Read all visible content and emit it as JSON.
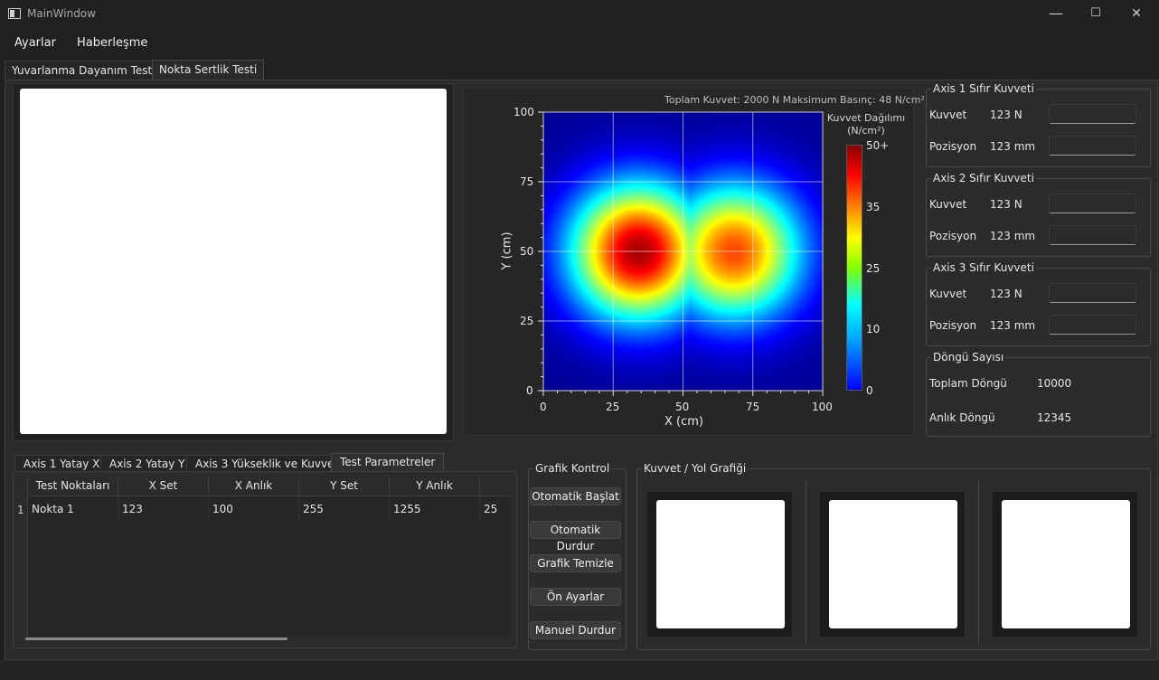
{
  "window": {
    "title": "MainWindow",
    "minimize": "—",
    "maximize": "☐",
    "close": "✕"
  },
  "menu": {
    "items": [
      "Ayarlar",
      "Haberleşme"
    ]
  },
  "main_tabs": [
    "Yuvarlanma Dayanım Testi",
    "Nokta Sertlik Testi"
  ],
  "main_tabs_active": "Nokta Sertlik Testi",
  "heatmap": {
    "info": "Toplam Kuvvet: 2000 N  Maksimum Basınç: 48 N/cm²",
    "colorbar_title_1": "Kuvvet Dağılımı",
    "colorbar_title_2": "(N/cm²)",
    "colorbar_ticks": [
      "50+",
      "35",
      "25",
      "10",
      "0"
    ],
    "x_ticks": [
      "0",
      "25",
      "50",
      "75",
      "100"
    ],
    "y_ticks": [
      "100",
      "75",
      "50",
      "25",
      "0"
    ],
    "xlabel": "X (cm)",
    "ylabel": "Y (cm)",
    "peaks": [
      {
        "x": 34,
        "y": 50,
        "value": 48
      },
      {
        "x": 68,
        "y": 50,
        "value": 40
      }
    ],
    "colormap": "jet",
    "range": [
      0,
      50
    ]
  },
  "axis_groups": [
    {
      "title": "Axis 1 Sıfır Kuvveti",
      "force_label": "Kuvvet",
      "force_value": "123 N",
      "pos_label": "Pozisyon",
      "pos_value": "123 mm"
    },
    {
      "title": "Axis 2 Sıfır Kuvveti",
      "force_label": "Kuvvet",
      "force_value": "123 N",
      "pos_label": "Pozisyon",
      "pos_value": "123 mm"
    },
    {
      "title": "Axis 3 Sıfır Kuvveti",
      "force_label": "Kuvvet",
      "force_value": "123 N",
      "pos_label": "Pozisyon",
      "pos_value": "123 mm"
    }
  ],
  "cycle_group": {
    "title": "Döngü Sayısı",
    "total_label": "Toplam Döngü",
    "total_value": "10000",
    "current_label": "Anlık Döngü",
    "current_value": "12345"
  },
  "sub_tabs": [
    "Axis 1 Yatay X",
    "Axis 2 Yatay Y",
    "Axis 3 Yükseklik ve Kuvvet",
    "Test Parametreler"
  ],
  "sub_tabs_active": "Test Parametreler",
  "table": {
    "columns": [
      "Test Noktaları",
      "X Set",
      "X Anlık",
      "Y Set",
      "Y Anlık",
      ""
    ],
    "rows": [
      {
        "index": "1",
        "cells": [
          "Nokta 1",
          "123",
          "100",
          "255",
          "1255",
          "25"
        ]
      }
    ]
  },
  "graph_control": {
    "title": "Grafik Kontrol",
    "buttons": [
      "Otomatik Başlat",
      "Otomatik Durdur",
      "Grafik Temizle",
      "Ön Ayarlar",
      "Manuel Durdur"
    ]
  },
  "force_graph": {
    "title": "Kuvvet / Yol Grafiği"
  }
}
